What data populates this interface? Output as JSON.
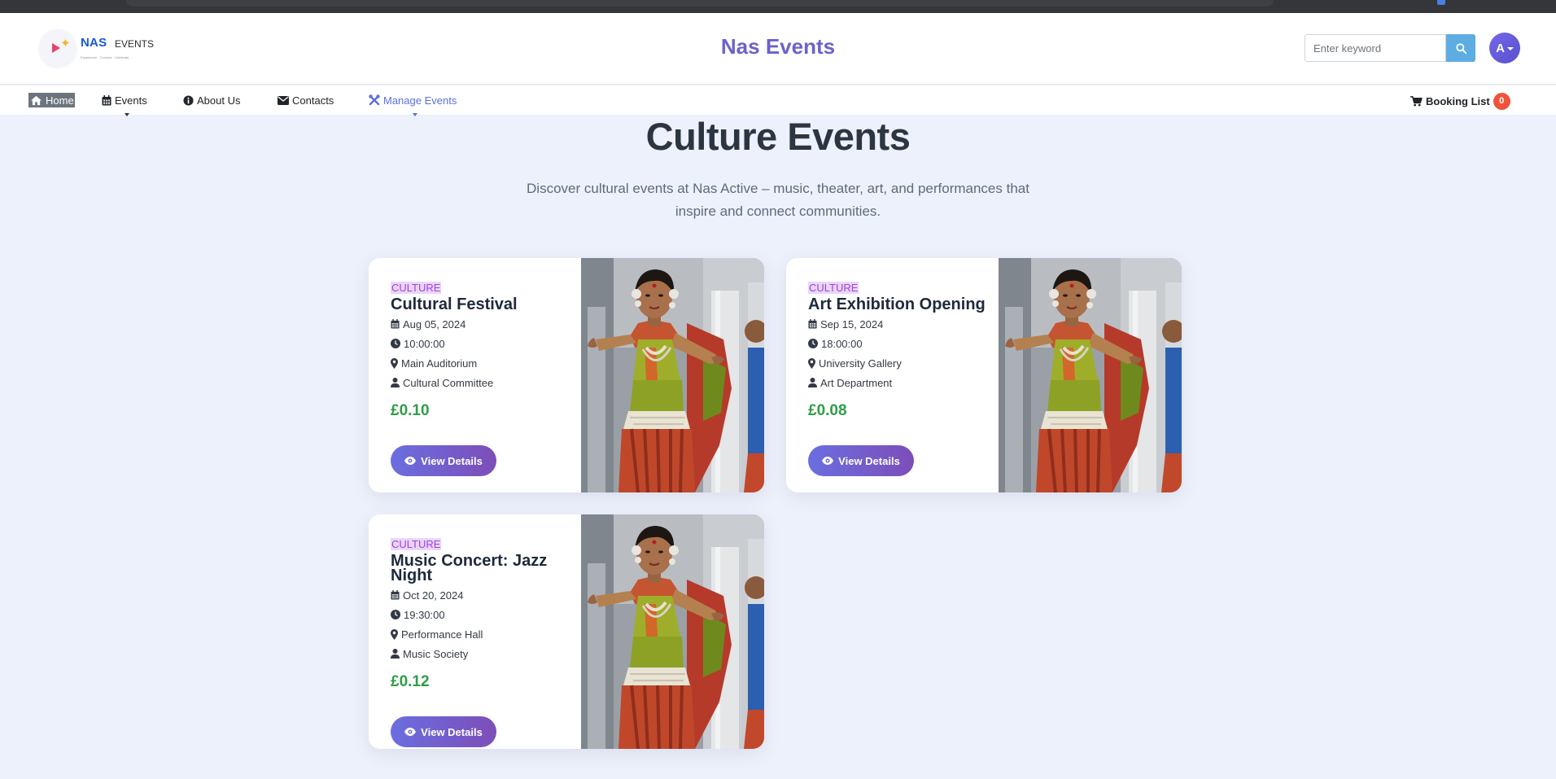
{
  "header": {
    "logo": {
      "brand": "NAS",
      "brand_secondary": "EVENTS",
      "tagline": "Experience · Connect · Celebrate"
    },
    "site_title": "Nas Events",
    "search": {
      "placeholder": "Enter keyword",
      "value": ""
    },
    "user_avatar": "A"
  },
  "nav": {
    "items": [
      {
        "label": "Home",
        "icon": "home-icon",
        "active": true
      },
      {
        "label": "Events",
        "icon": "calendar-icon"
      },
      {
        "label": "About Us",
        "icon": "info-circle-icon"
      },
      {
        "label": "Contacts",
        "icon": "envelope-icon"
      },
      {
        "label": "Manage Events",
        "icon": "tools-icon"
      }
    ],
    "booking": {
      "label": "Booking List",
      "count": "0",
      "icon": "cart-icon"
    }
  },
  "page": {
    "title": "Culture Events",
    "subtitle": "Discover cultural events at Nas Active – music, theater, art, and performances that inspire and connect communities."
  },
  "events": [
    {
      "category": "CULTURE",
      "title": "Cultural Festival",
      "date": "Aug 05, 2024",
      "time": "10:00:00",
      "venue": "Main Auditorium",
      "organizer": "Cultural Committee",
      "price": "£0.10",
      "button": "View Details"
    },
    {
      "category": "CULTURE",
      "title": "Art Exhibition Opening",
      "date": "Sep 15, 2024",
      "time": "18:00:00",
      "venue": "University Gallery",
      "organizer": "Art Department",
      "price": "£0.08",
      "button": "View Details"
    },
    {
      "category": "CULTURE",
      "title": "Music Concert: Jazz Night",
      "date": "Oct 20, 2024",
      "time": "19:30:00",
      "venue": "Performance Hall",
      "organizer": "Music Society",
      "price": "£0.12",
      "button": "View Details"
    }
  ],
  "colors": {
    "accent": "#6a63c9",
    "price": "#2e9e46",
    "category": "#a044d8",
    "badge": "#f0533a",
    "button_start": "#6a6ee0",
    "button_end": "#7d4eb8"
  }
}
